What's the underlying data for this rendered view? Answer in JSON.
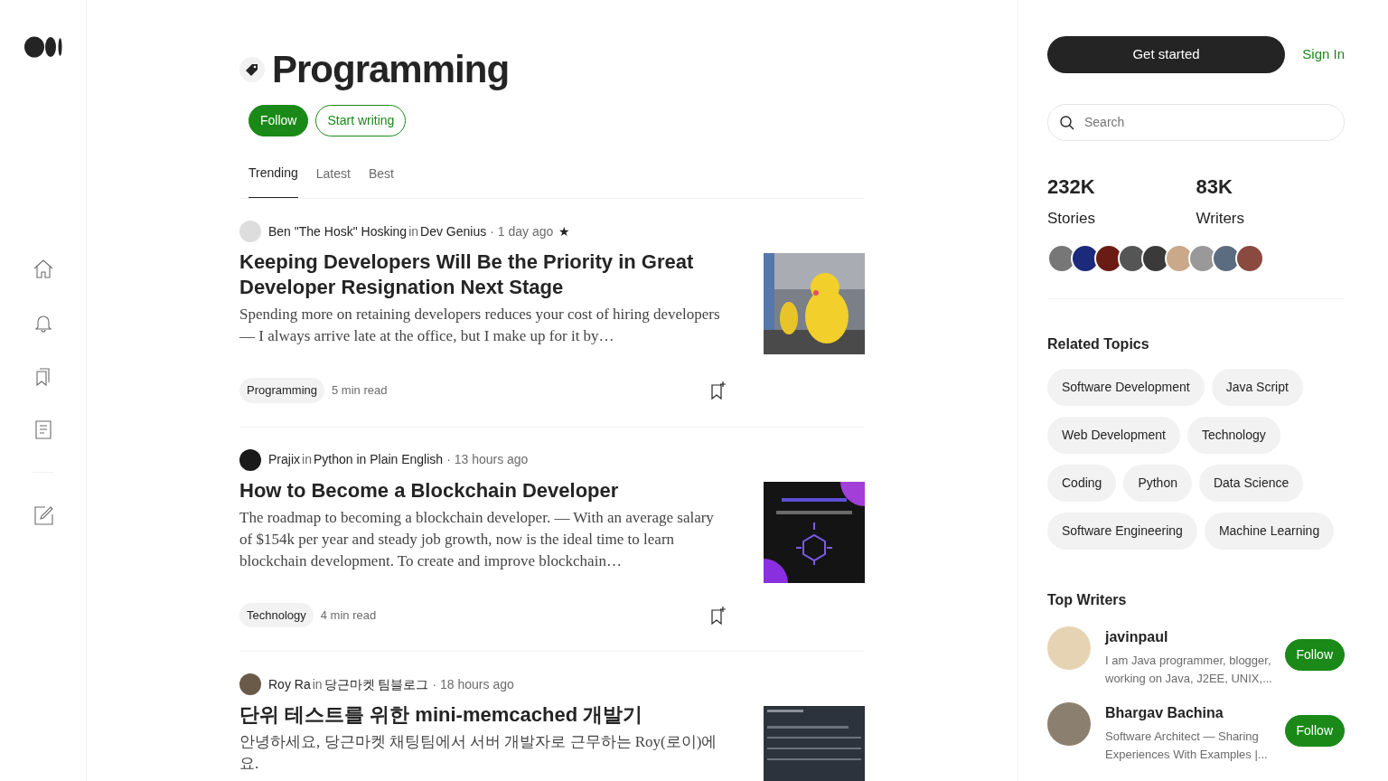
{
  "topic": {
    "title": "Programming"
  },
  "topic_buttons": [
    {
      "label": "Follow",
      "kind": "filled"
    },
    {
      "label": "Start writing",
      "kind": "outline"
    }
  ],
  "tabs": [
    {
      "label": "Trending",
      "selected": true
    },
    {
      "label": "Latest",
      "selected": false
    },
    {
      "label": "Best",
      "selected": false
    }
  ],
  "articles": [
    {
      "author": "Ben \"The Hosk\" Hosking",
      "in": "in",
      "publication": "Dev Genius",
      "time": "· 1 day ago",
      "star": "★",
      "title": "Keeping Developers Will Be the Priority in Great Developer Resignation Next Stage",
      "subtitle": "Spending more on retaining developers reduces your cost of hiring developers — I always arrive late at the office, but I make up for it by…",
      "tag": "Programming",
      "read_time": "5 min read"
    },
    {
      "author": "Prajix",
      "in": "in",
      "publication": "Python in Plain English",
      "time": "· 13 hours ago",
      "title": "How to Become a Blockchain Developer",
      "subtitle": "The roadmap to becoming a blockchain developer. — With an average salary of $154k per year and steady job growth, now is the ideal time to learn blockchain development. To create and improve blockchain…",
      "tag": "Technology",
      "read_time": "4 min read"
    },
    {
      "author": "Roy Ra",
      "in": "in",
      "publication": "당근마켓 팀블로그",
      "time": "· 18 hours ago",
      "title": "단위 테스트를 위한 mini-memcached 개발기",
      "subtitle": "안녕하세요, 당근마켓 채팅팀에서 서버 개발자로 근무하는 Roy(로이)에요."
    }
  ],
  "header": {
    "get_started": "Get started",
    "sign_in": "Sign In"
  },
  "search": {
    "placeholder": "Search"
  },
  "stats": [
    {
      "value": "232K",
      "label": "Stories"
    },
    {
      "value": "83K",
      "label": "Writers"
    }
  ],
  "related_topics": {
    "title": "Related Topics",
    "items": [
      "Software Development",
      "Java Script",
      "Web Development",
      "Technology",
      "Coding",
      "Python",
      "Data Science",
      "Software Engineering",
      "Machine Learning"
    ]
  },
  "top_writers": {
    "title": "Top Writers",
    "items": [
      {
        "name": "javinpaul",
        "bio": "I am Java programmer, blogger, working on Java, J2EE, UNIX,...",
        "button": "Follow"
      },
      {
        "name": "Bhargav Bachina",
        "bio": "Software Architect — Sharing Experiences With Examples |...",
        "button": "Follow"
      }
    ]
  }
}
